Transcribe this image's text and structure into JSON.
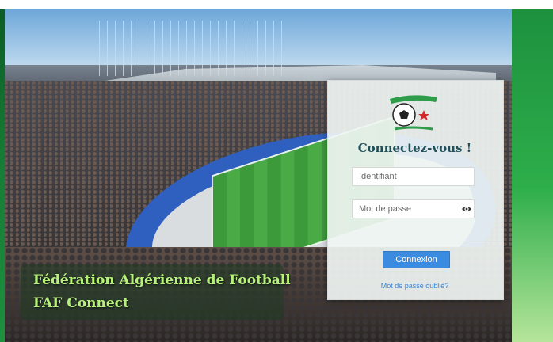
{
  "brand": {
    "line1": "Fédération Algérienne de Football",
    "line2": "FAF Connect"
  },
  "login": {
    "title": "Connectez-vous !",
    "username_placeholder": "Identifiant",
    "password_placeholder": "Mot de passe",
    "submit_label": "Connexion",
    "forgot_link": "Mot de passe oublié?"
  },
  "icons": {
    "logo": "faf-logo",
    "password_toggle": "eye-icon"
  },
  "colors": {
    "accent": "#3b8be0",
    "title": "#1f4f58",
    "brand_text": "#b6f27a"
  }
}
